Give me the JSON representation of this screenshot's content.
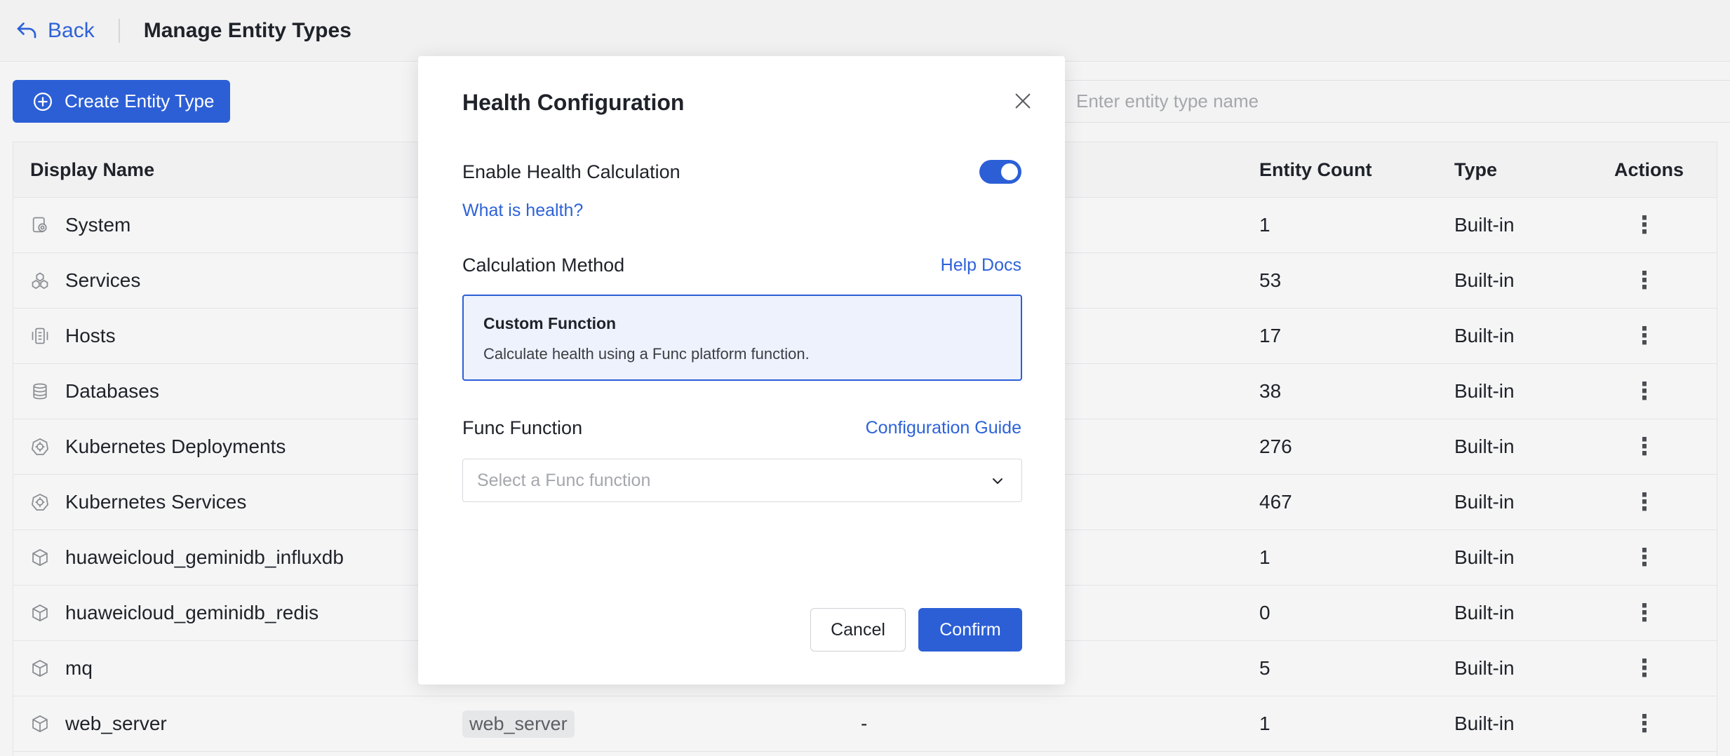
{
  "header": {
    "back_label": "Back",
    "page_title": "Manage Entity Types"
  },
  "toolbar": {
    "create_label": "Create Entity Type",
    "search_placeholder": "Enter entity type name"
  },
  "table": {
    "columns": {
      "display_name": "Display Name",
      "entity_count": "Entity Count",
      "type": "Type",
      "actions": "Actions"
    },
    "rows": [
      {
        "name": "System",
        "icon": "system-icon",
        "count": "1",
        "type": "Built-in"
      },
      {
        "name": "Services",
        "icon": "services-icon",
        "count": "53",
        "type": "Built-in"
      },
      {
        "name": "Hosts",
        "icon": "hosts-icon",
        "count": "17",
        "type": "Built-in"
      },
      {
        "name": "Databases",
        "icon": "database-icon",
        "count": "38",
        "type": "Built-in"
      },
      {
        "name": "Kubernetes Deployments",
        "icon": "kubernetes-icon",
        "count": "276",
        "type": "Built-in"
      },
      {
        "name": "Kubernetes Services",
        "icon": "kubernetes-icon",
        "count": "467",
        "type": "Built-in"
      },
      {
        "name": "huaweicloud_geminidb_influxdb",
        "icon": "cube-icon",
        "count": "1",
        "type": "Built-in"
      },
      {
        "name": "huaweicloud_geminidb_redis",
        "icon": "cube-icon",
        "count": "0",
        "type": "Built-in"
      },
      {
        "name": "mq",
        "icon": "cube-icon",
        "count": "5",
        "type": "Built-in"
      },
      {
        "name": "web_server",
        "icon": "cube-icon",
        "id": "web_server",
        "description": "-",
        "count": "1",
        "type": "Built-in"
      }
    ]
  },
  "modal": {
    "title": "Health Configuration",
    "enable_label": "Enable Health Calculation",
    "enable_on": true,
    "what_is_health": "What is health?",
    "method_label": "Calculation Method",
    "help_docs": "Help Docs",
    "method_card": {
      "title": "Custom Function",
      "description": "Calculate health using a Func platform function."
    },
    "func_label": "Func Function",
    "config_guide": "Configuration Guide",
    "func_placeholder": "Select a Func function",
    "cancel_label": "Cancel",
    "confirm_label": "Confirm"
  },
  "colors": {
    "accent": "#2c5fd6",
    "link": "#2e62d8"
  }
}
